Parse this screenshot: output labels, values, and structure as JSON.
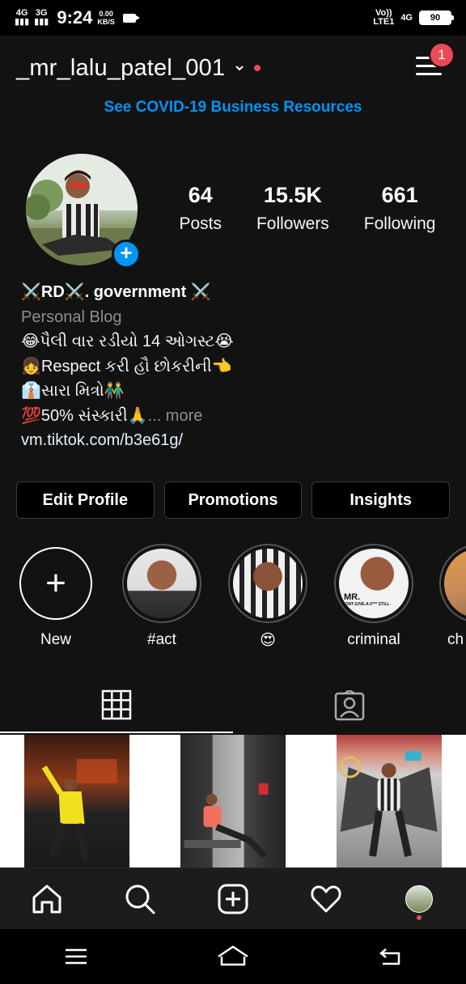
{
  "status_bar": {
    "network1": "4G",
    "network2": "3G",
    "time": "9:24",
    "speed_value": "0.00",
    "speed_unit": "KB/S",
    "volte_top": "Vo))",
    "volte_bottom": "LTE1",
    "network_right": "4G",
    "battery": "90"
  },
  "header": {
    "username": "_mr_lalu_patel_001",
    "notification_count": "1"
  },
  "covid_link": "See COVID-19 Business Resources",
  "stats": [
    {
      "value": "64",
      "label": "Posts"
    },
    {
      "value": "15.5K",
      "label": "Followers"
    },
    {
      "value": "661",
      "label": "Following"
    }
  ],
  "bio": {
    "name": "⚔️RD⚔️.   government ⚔️",
    "category": "Personal Blog",
    "line1": "😂પૈલી વાર રડીયો 14 ઓગસ્ટ😭",
    "line2": "👧Respect કરી હૌ છોકરીની👈",
    "line3": "👔સારા મિત્રો👬",
    "line4": "💯50% સંસ્કારી🙏",
    "more": "... more",
    "link": "vm.tiktok.com/b3e61g/"
  },
  "buttons": {
    "edit_profile": "Edit Profile",
    "promotions": "Promotions",
    "insights": "Insights"
  },
  "highlights": [
    {
      "label": "New"
    },
    {
      "label": "#act"
    },
    {
      "label": "😍"
    },
    {
      "label": "criminal"
    },
    {
      "label": "ch"
    }
  ],
  "highlight_overlay_text": {
    "title": "MR.",
    "subtitle": "DONT-GIVE-A-F*** STILL"
  },
  "colors": {
    "accent_blue": "#0095f6",
    "notification_red": "#ed4956",
    "background": "#121212"
  },
  "icons": {
    "home": "home-icon",
    "search": "search-icon",
    "add": "add-post-icon",
    "activity": "heart-icon",
    "profile": "profile-avatar-icon"
  }
}
